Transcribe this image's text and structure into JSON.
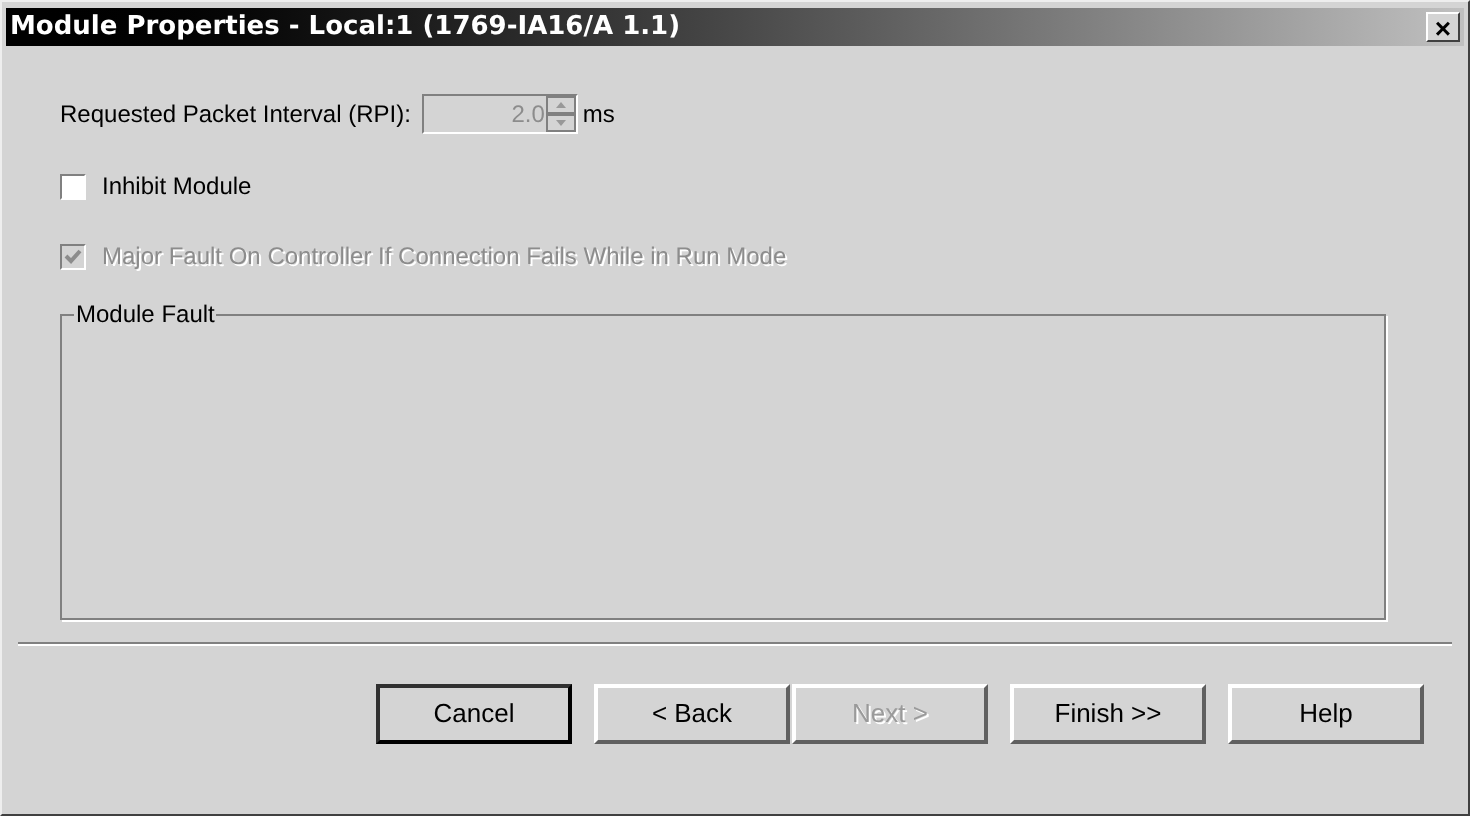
{
  "window": {
    "title": "Module Properties - Local:1 (1769-IA16/A 1.1)",
    "close": "×"
  },
  "rpi": {
    "label": "Requested Packet Interval (RPI):",
    "value": "2.0",
    "unit": "ms",
    "disabled": true
  },
  "checkboxes": [
    {
      "label": "Inhibit Module",
      "checked": false,
      "disabled": false
    },
    {
      "label": "Major Fault On Controller If Connection Fails While in Run Mode",
      "checked": true,
      "disabled": true
    }
  ],
  "group": {
    "title": "Module Fault"
  },
  "buttons": [
    {
      "label": "Cancel",
      "default": true,
      "disabled": false
    },
    {
      "label": "< Back",
      "default": false,
      "disabled": false
    },
    {
      "label": "Next >",
      "default": false,
      "disabled": true
    },
    {
      "label": "Finish >>",
      "default": false,
      "disabled": false
    },
    {
      "label": "Help",
      "default": false,
      "disabled": false
    }
  ]
}
